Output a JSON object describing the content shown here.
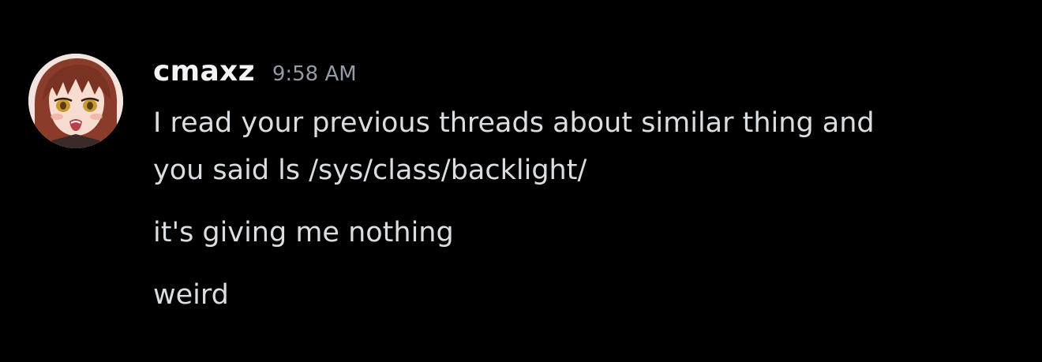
{
  "message": {
    "author": "cmaxz",
    "timestamp": "9:58 AM",
    "avatar_icon": "anime-avatar-icon",
    "lines": [
      "I read your previous threads about similar thing and",
      "you said ls /sys/class/backlight/",
      "it's giving me nothing",
      "weird"
    ]
  },
  "colors": {
    "background": "#000000",
    "username": "#f2f3f5",
    "timestamp": "#949ba4",
    "text": "#dbdee1"
  }
}
